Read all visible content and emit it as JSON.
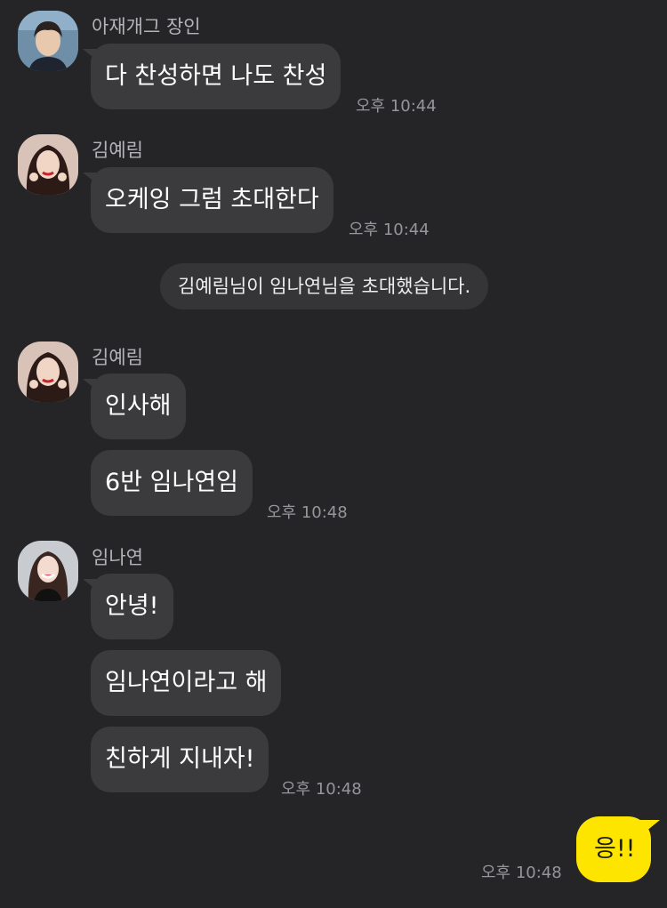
{
  "colors": {
    "background": "#252528",
    "bubble_other": "#3b3b3e",
    "bubble_mine": "#fee500",
    "time_text": "#96969a"
  },
  "blocks": [
    {
      "sender": "아재개그 장인",
      "messages": [
        "다 찬성하면 나도 찬성"
      ],
      "time": "오후 10:44"
    },
    {
      "sender": "김예림",
      "messages": [
        "오케잉 그럼 초대한다"
      ],
      "time": "오후 10:44"
    },
    {
      "system": "김예림님이 임나연님을 초대했습니다."
    },
    {
      "sender": "김예림",
      "messages": [
        "인사해",
        "6반 임나연임"
      ],
      "time": "오후 10:48"
    },
    {
      "sender": "임나연",
      "messages": [
        "안녕!",
        "임나연이라고 해",
        "친하게 지내자!"
      ],
      "time": "오후 10:48"
    },
    {
      "mine": "응!!",
      "time": "오후 10:48"
    }
  ]
}
